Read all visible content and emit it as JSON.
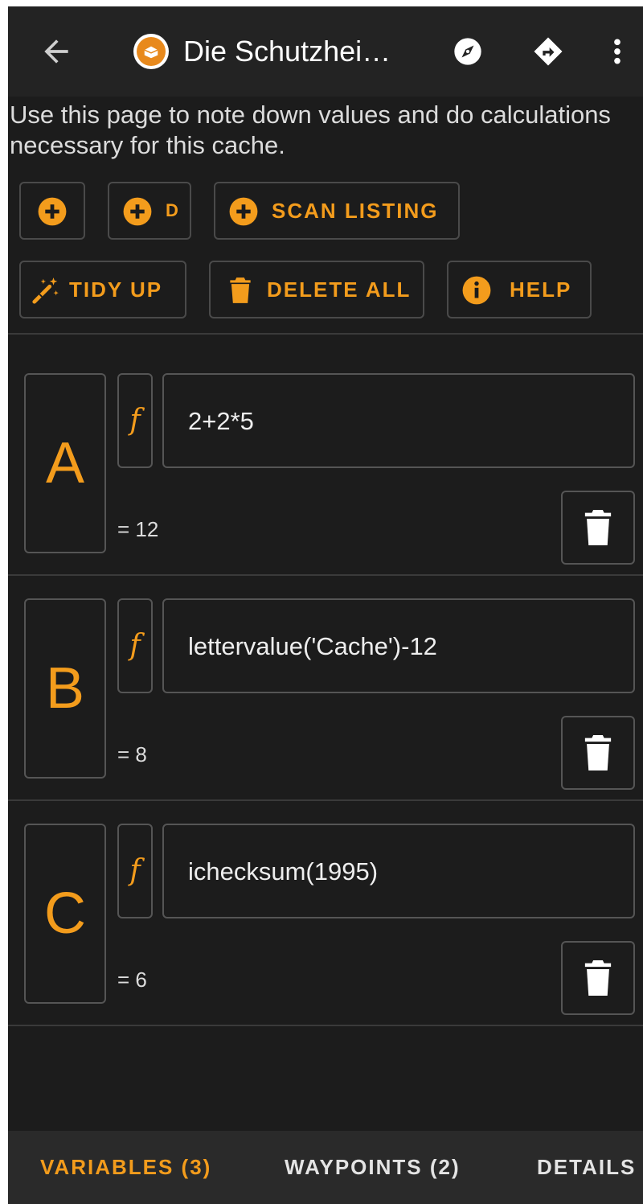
{
  "app_bar": {
    "title": "Die Schutzhei…",
    "icons": [
      "arrow-left-icon",
      "cache-type-icon",
      "compass-icon",
      "directions-icon",
      "more-vertical-icon"
    ]
  },
  "description": "Use this page to note down values and do calculations necessary for this cache.",
  "toolbar": {
    "add_label": "",
    "add_d_label": "D",
    "scan_listing_label": "SCAN LISTING",
    "tidy_up_label": "TIDY UP",
    "delete_all_label": "DELETE ALL",
    "help_label": "HELP"
  },
  "variables": [
    {
      "letter": "A",
      "formula": "2+2*5",
      "result": "= 12"
    },
    {
      "letter": "B",
      "formula": "lettervalue('Cache')-12",
      "result": "= 8"
    },
    {
      "letter": "C",
      "formula": "ichecksum(1995)",
      "result": "= 6"
    }
  ],
  "formula_toggle_label": "f",
  "tabs": [
    {
      "label": "VARIABLES (3)",
      "active": true
    },
    {
      "label": "WAYPOINTS (2)",
      "active": false
    },
    {
      "label": "DETAILS",
      "active": false
    }
  ],
  "colors": {
    "accent": "#f39c1c",
    "background": "#1c1c1c",
    "app_bar": "#232323",
    "tab_bar": "#2a2a2a"
  }
}
